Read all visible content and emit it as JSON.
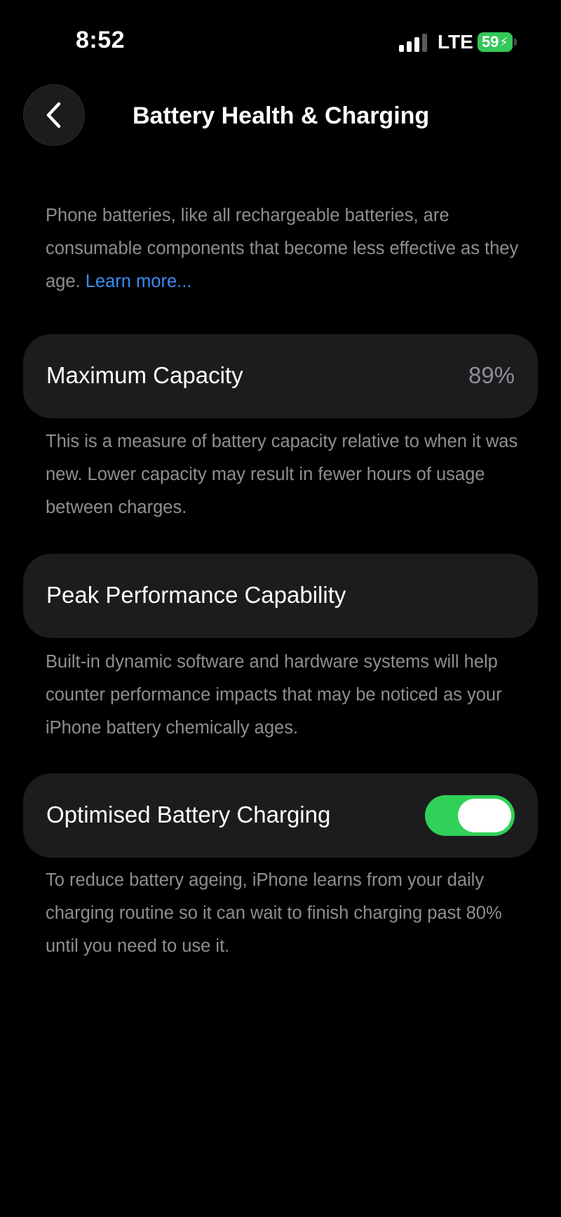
{
  "status_bar": {
    "time": "8:52",
    "network": "LTE",
    "battery_level": "59",
    "signal_icon": "signal-bars-icon",
    "battery_icon": "battery-charging-icon",
    "battery_color": "#34c759"
  },
  "header": {
    "title": "Battery Health & Charging",
    "back_icon": "chevron-left-icon"
  },
  "intro": {
    "text": "Phone batteries, like all rechargeable batteries, are consumable components that become less effective as they age. ",
    "link_label": "Learn more...",
    "link_color": "#3a8cf5"
  },
  "maximum_capacity": {
    "label": "Maximum Capacity",
    "value": "89%",
    "description": "This is a measure of battery capacity relative to when it was new. Lower capacity may result in fewer hours of usage between charges."
  },
  "peak_performance": {
    "label": "Peak Performance Capability",
    "description": "Built-in dynamic software and hardware systems will help counter performance impacts that may be noticed as your iPhone battery chemically ages."
  },
  "optimised_charging": {
    "label": "Optimised Battery Charging",
    "toggle_on": true,
    "toggle_color": "#30d158",
    "description": "To reduce battery ageing, iPhone learns from your daily charging routine so it can wait to finish charging past 80% until you need to use it."
  }
}
